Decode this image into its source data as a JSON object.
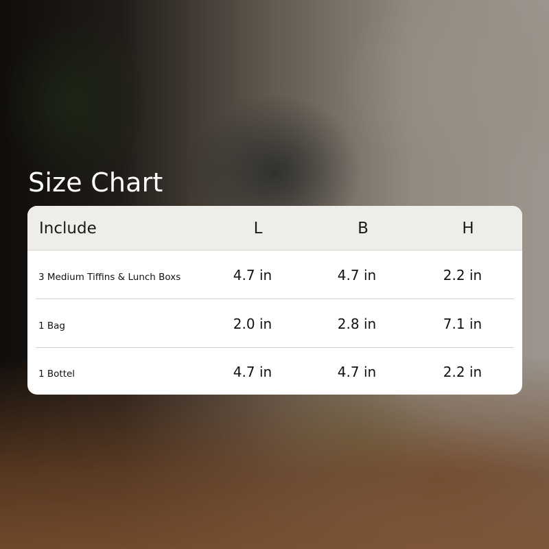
{
  "title": "Size Chart",
  "table": {
    "headers": [
      "Include",
      "L",
      "B",
      "H"
    ],
    "rows": [
      {
        "item": "3 Medium Tiffins & Lunch Boxs",
        "l": "4.7 in",
        "b": "4.7 in",
        "h": "2.2 in"
      },
      {
        "item": "1 Bag",
        "l": "2.0 in",
        "b": "2.8 in",
        "h": "7.1 in"
      },
      {
        "item": "1 Bottel",
        "l": "4.7 in",
        "b": "4.7 in",
        "h": "2.2 in"
      }
    ]
  },
  "colors": {
    "header_bg": "#efedea",
    "card_bg": "#ffffff",
    "title_text": "#ffffff",
    "body_text": "#111111"
  }
}
